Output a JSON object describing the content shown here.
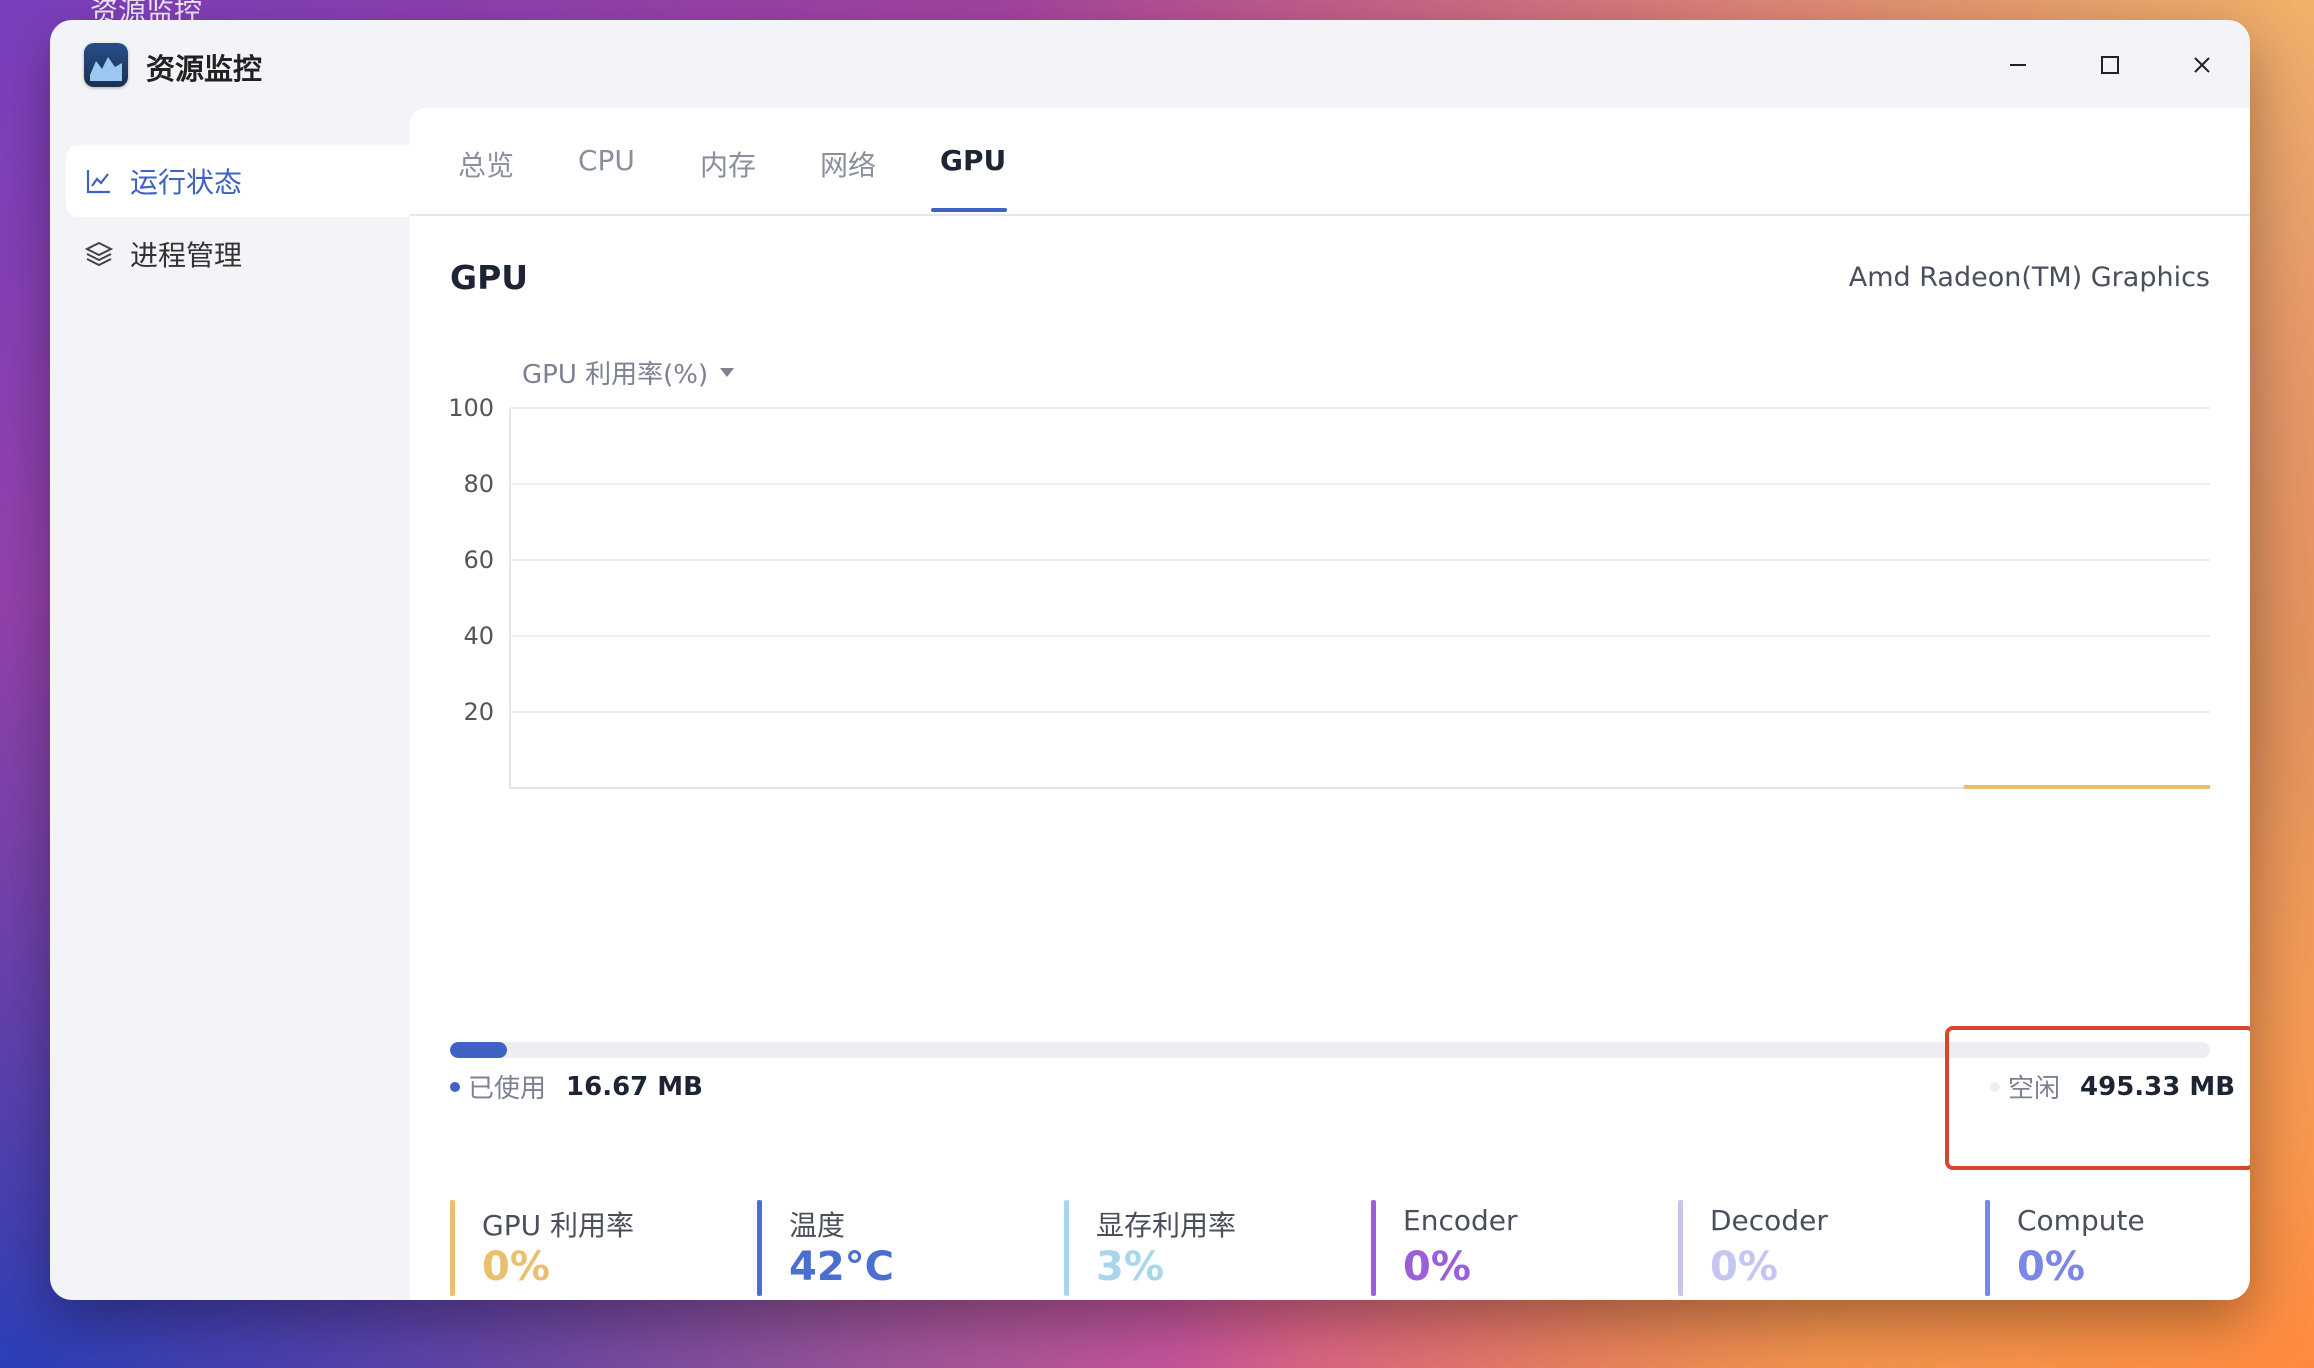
{
  "desktop": {
    "title": "资源监控"
  },
  "window": {
    "title": "资源监控"
  },
  "sidebar": {
    "items": [
      {
        "label": "运行状态",
        "icon": "line-chart-icon",
        "active": true
      },
      {
        "label": "进程管理",
        "icon": "layers-icon",
        "active": false
      }
    ]
  },
  "tabs": [
    {
      "label": "总览"
    },
    {
      "label": "CPU"
    },
    {
      "label": "内存"
    },
    {
      "label": "网络"
    },
    {
      "label": "GPU"
    }
  ],
  "active_tab": "GPU",
  "gpu": {
    "title": "GPU",
    "device_name": "Amd Radeon(TM) Graphics",
    "metric_select": "GPU 利用率(%)"
  },
  "chart_data": {
    "type": "line",
    "ylim": [
      0,
      100
    ],
    "yticks": [
      "100",
      "80",
      "60",
      "40",
      "20"
    ],
    "grid": true,
    "series": [
      {
        "values": [
          0,
          0
        ],
        "x_range_fraction": [
          0.855,
          1.0
        ],
        "color": "#e8c070"
      }
    ]
  },
  "memory": {
    "used_label": "已使用",
    "used_value": "16.67 MB",
    "free_label": "空闲",
    "free_value": "495.33 MB",
    "used_fraction": 0.0326,
    "used_color": "#3f63c5"
  },
  "stats": [
    {
      "name": "GPU 利用率",
      "value": "0%",
      "color": "#e8c070"
    },
    {
      "name": "温度",
      "value": "42°C",
      "color": "#4a6fd0"
    },
    {
      "name": "显存利用率",
      "value": "3%",
      "color": "#a9d6ea"
    },
    {
      "name": "Encoder",
      "value": "0%",
      "color": "#9c5fdc"
    },
    {
      "name": "Decoder",
      "value": "0%",
      "color": "#c4c6f0"
    },
    {
      "name": "Compute",
      "value": "0%",
      "color": "#7b87e8"
    }
  ]
}
